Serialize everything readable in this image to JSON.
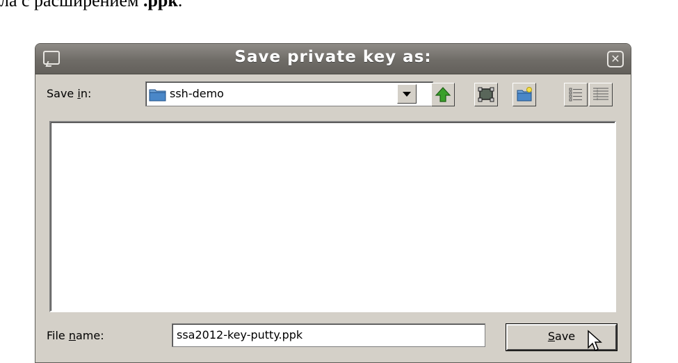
{
  "document": {
    "text_prefix": "ла с расширением ",
    "text_bold": ".ppk",
    "text_suffix": "."
  },
  "dialog": {
    "title": "Save private key as:",
    "close_symbol": "✕",
    "save_in": {
      "label_before": "Save ",
      "label_mnemonic": "i",
      "label_after": "n:",
      "value": "ssh-demo"
    },
    "toolbar": [
      "up-one-level-icon",
      "desktop-icon",
      "new-folder-icon",
      "list-view-icon",
      "details-view-icon"
    ],
    "file_name": {
      "label_before": "File ",
      "label_mnemonic": "n",
      "label_after": "ame:",
      "value": "ssa2012-key-putty.ppk"
    },
    "save_button": {
      "mnemonic": "S",
      "rest": "ave"
    }
  },
  "colors": {
    "titlebar": "#6f6c67",
    "dialog_bg": "#d4d0c8",
    "folder": "#4a87c8",
    "up_arrow": "#3aa02a"
  }
}
